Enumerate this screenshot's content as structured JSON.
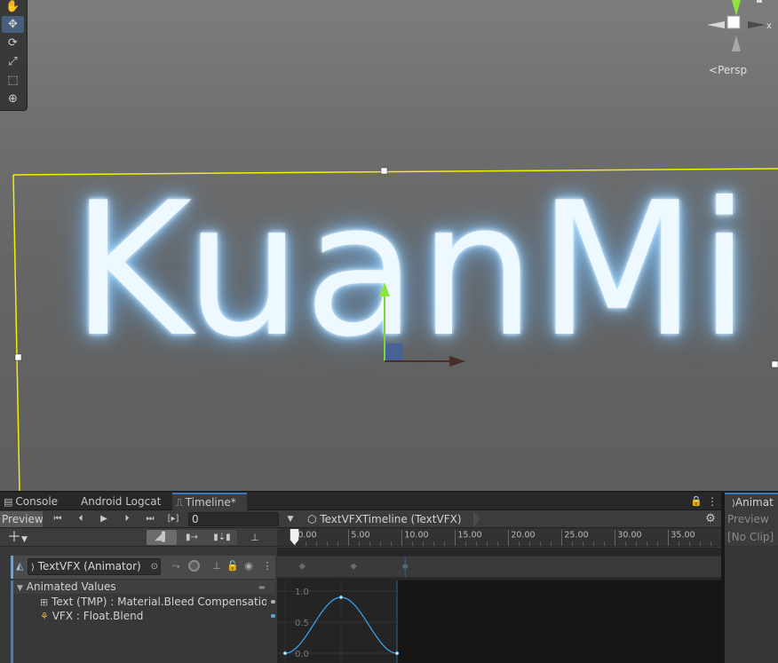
{
  "scene": {
    "persp_label": "Persp",
    "gizmo_axis_x": "x",
    "scene_text": "KuanMi",
    "tools": [
      {
        "icon": "hand-icon",
        "glyph": "✋",
        "active": false
      },
      {
        "icon": "move-icon",
        "glyph": "✥",
        "active": true
      },
      {
        "icon": "rotate-icon",
        "glyph": "⟳",
        "active": false
      },
      {
        "icon": "scale-icon",
        "glyph": "⤢",
        "active": false
      },
      {
        "icon": "rect-icon",
        "glyph": "⬚",
        "active": false
      },
      {
        "icon": "transform-icon",
        "glyph": "⊕",
        "active": false
      }
    ]
  },
  "tabs": {
    "console": "Console",
    "logcat": "Android Logcat",
    "timeline": "Timeline*",
    "animation": "Animat"
  },
  "toolbar": {
    "preview": "Preview",
    "frame_value": "0",
    "asset": "TextVFXTimeline (TextVFX)"
  },
  "ruler": {
    "ticks": [
      "0.00",
      "5.00",
      "10.00",
      "15.00",
      "20.00",
      "25.00",
      "30.00",
      "35.00"
    ]
  },
  "track": {
    "name": "TextVFX (Animator)"
  },
  "animated_values": {
    "header": "Animated Values",
    "properties": [
      "Text (TMP) : Material.Bleed Compensation",
      "VFX : Float.Blend"
    ]
  },
  "curve": {
    "y_labels": [
      "1.0",
      "0.5",
      "0.0"
    ],
    "keys": [
      {
        "time": 0,
        "value": 0.0
      },
      {
        "time": 5,
        "value": 0.9
      },
      {
        "time": 10,
        "value": 0.0
      }
    ]
  },
  "animation_window": {
    "preview": "Preview",
    "no_clip": "[No Clip]"
  },
  "colors": {
    "selection_accent": "#3a79bb",
    "curve": "#3a9ee8",
    "gizmo_y": "#8ce63c",
    "bounds": "#f0f000"
  }
}
